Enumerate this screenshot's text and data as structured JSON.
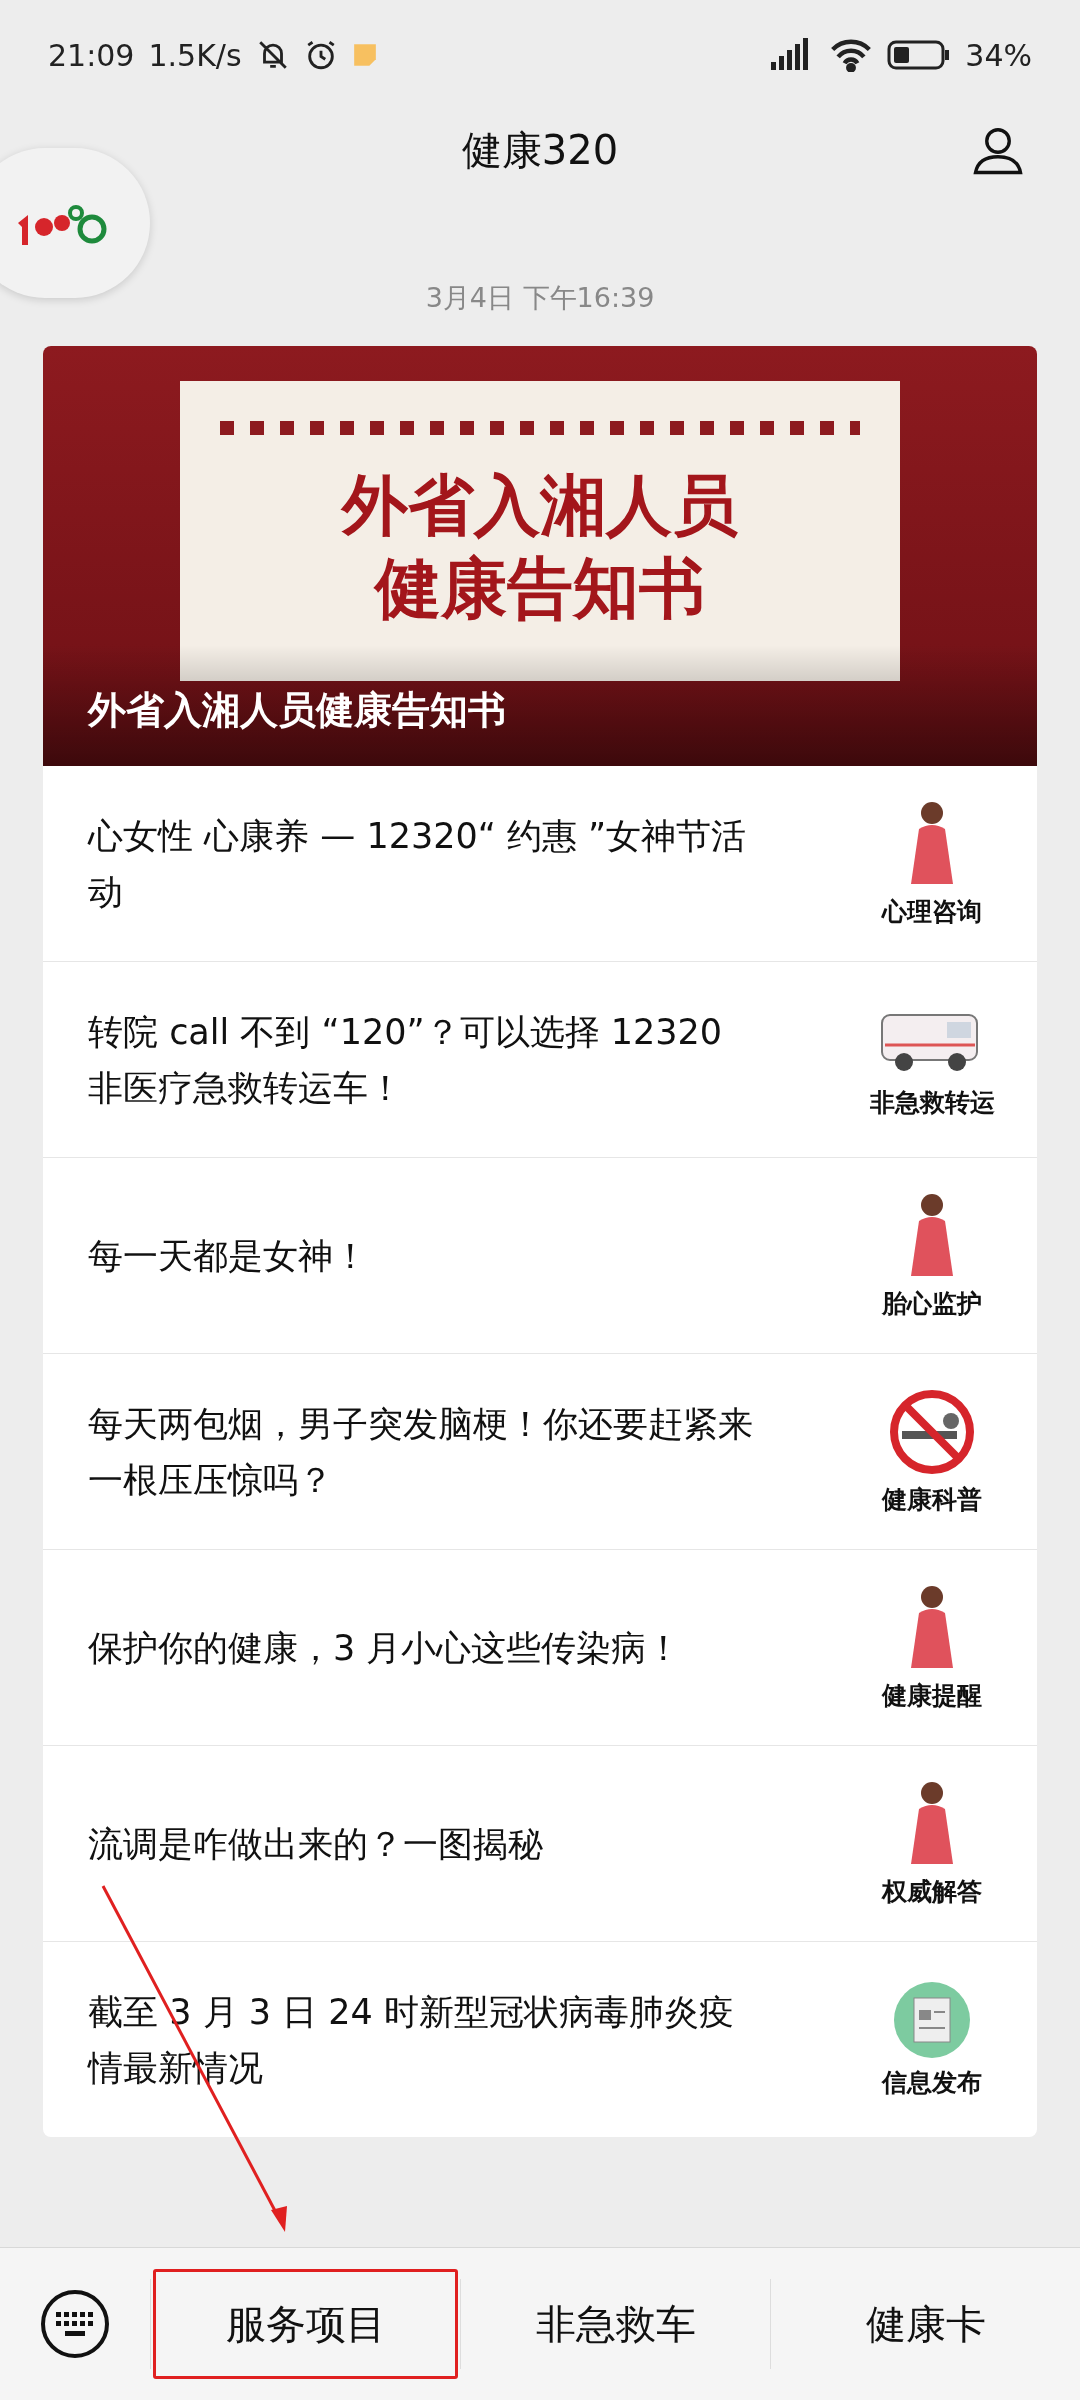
{
  "status_bar": {
    "time": "21:09",
    "speed": "1.5K/s",
    "battery": "34%"
  },
  "header": {
    "title": "健康320"
  },
  "timestamp": "3月4日 下午16:39",
  "cover": {
    "poster_line_1": "外省入湘人员",
    "poster_line_2": "健康告知书",
    "caption": "外省入湘人员健康告知书"
  },
  "articles": [
    {
      "title": "心女性 心康养 — 12320“ 约惠 ”女神节活动",
      "kind": "figure",
      "thumb_label": "心理咨询"
    },
    {
      "title": "转院 call 不到 “120”？可以选择 12320 非医疗急救转运车！",
      "kind": "van",
      "thumb_label": "非急救转运"
    },
    {
      "title": "每一天都是女神！",
      "kind": "figure",
      "thumb_label": "胎心监护"
    },
    {
      "title": "每天两包烟，男子突发脑梗！你还要赶紧来一根压压惊吗？",
      "kind": "no-smoking",
      "thumb_label": "健康科普"
    },
    {
      "title": "保护你的健康，3 月小心这些传染病！",
      "kind": "figure",
      "thumb_label": "健康提醒"
    },
    {
      "title": "流调是咋做出来的？一图揭秘",
      "kind": "figure",
      "thumb_label": "权威解答"
    },
    {
      "title": "截至 3 月 3 日 24 时新型冠状病毒肺炎疫情最新情况",
      "kind": "newspaper",
      "thumb_label": "信息发布"
    }
  ],
  "menu": [
    {
      "label": "服务项目",
      "highlighted": true
    },
    {
      "label": "非急救车",
      "highlighted": false
    },
    {
      "label": "健康卡",
      "highlighted": false
    }
  ]
}
